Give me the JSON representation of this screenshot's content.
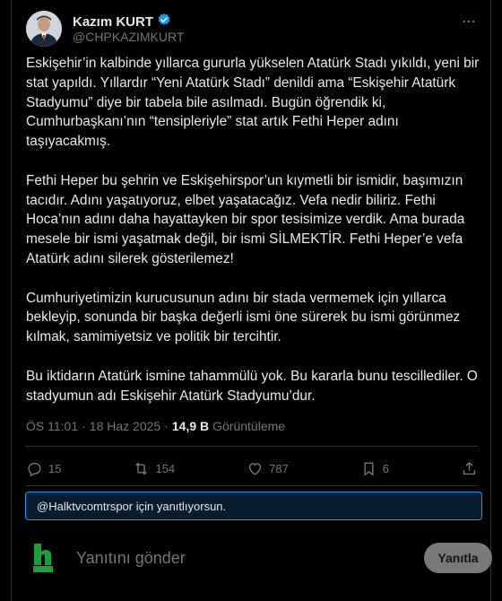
{
  "author": {
    "name": "Kazım KURT",
    "handle": "@CHPKAZIMKURT"
  },
  "tweet": {
    "paragraphs": [
      "Eskişehir’in kalbinde yıllarca gururla yükselen Atatürk Stadı yıkıldı, yeni bir stat yapıldı. Yıllardır “Yeni Atatürk Stadı” denildi ama “Eskişehir Atatürk Stadyumu” diye bir tabela bile asılmadı. Bugün öğrendik ki, Cumhurbaşkanı’nın “tensipleriyle” stat artık Fethi Heper adını taşıyacakmış.",
      "Fethi Heper bu şehrin ve Eskişehirspor’un kıymetli bir ismidir, başımızın tacıdır. Adını yaşatıyoruz, elbet yaşatacağız. Vefa nedir biliriz. Fethi Hoca’nın adını daha hayattayken bir spor tesisimize verdik. Ama burada mesele bir ismi yaşatmak değil, bir ismi SİLMEKTİR. Fethi Heper’e vefa Atatürk adını silerek gösterilemez!",
      "Cumhuriyetimizin kurucusunun adını bir stada vermemek için yıllarca bekleyip, sonunda bir başka değerli ismi öne sürerek bu ismi görünmez kılmak, samimiyetsiz ve politik bir tercihtir.",
      "Bu iktidarın Atatürk ismine tahammülü yok. Bu kararla bunu tescillediler. O stadyumun adı Eskişehir Atatürk Stadyumu’dur."
    ],
    "time": "ÖS 11:01",
    "separator": "·",
    "date": "18 Haz 2025",
    "views_count": "14,9 B",
    "views_label": "Görüntüleme"
  },
  "actions": {
    "replies": "15",
    "reposts": "154",
    "likes": "787",
    "bookmarks": "6"
  },
  "reply_banner": "@Halktvcomtrspor için yanıtlıyorsun.",
  "composer": {
    "placeholder": "Yanıtını gönder",
    "button": "Yanıtla",
    "avatar_text": "halk"
  },
  "colors": {
    "background": "#000000",
    "accent": "#1d9bf0",
    "muted": "#71767b",
    "text": "#e7e9ea",
    "halk_green": "#1a9f3c"
  }
}
